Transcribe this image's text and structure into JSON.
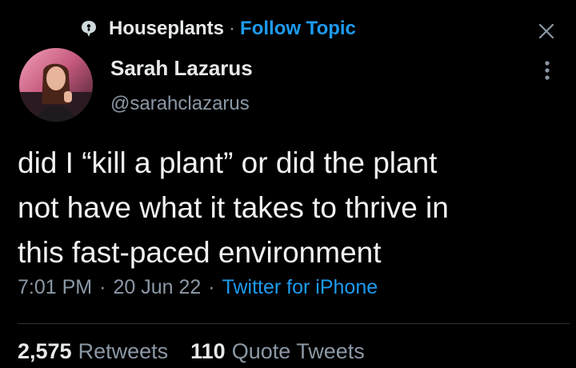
{
  "topic": {
    "name": "Houseplants",
    "separator": "·",
    "follow_label": "Follow Topic"
  },
  "author": {
    "display_name": "Sarah Lazarus",
    "handle": "@sarahclazarus"
  },
  "tweet": {
    "text": "did I “kill a plant” or did the plant\nnot have what it takes to thrive in\nthis fast-paced environment"
  },
  "meta": {
    "time": "7:01 PM",
    "separator": "·",
    "date": "20 Jun 22",
    "source": "Twitter for iPhone"
  },
  "stats": {
    "retweets_count": "2,575",
    "retweets_label": "Retweets",
    "quotes_count": "110",
    "quotes_label": "Quote Tweets"
  },
  "icons": {
    "topic": "topic-bubble-icon",
    "close": "close-icon",
    "more": "more-vertical-icon"
  },
  "colors": {
    "background": "#000000",
    "text": "#e7e9ea",
    "muted": "#8b98a5",
    "accent": "#1d9bf0"
  }
}
